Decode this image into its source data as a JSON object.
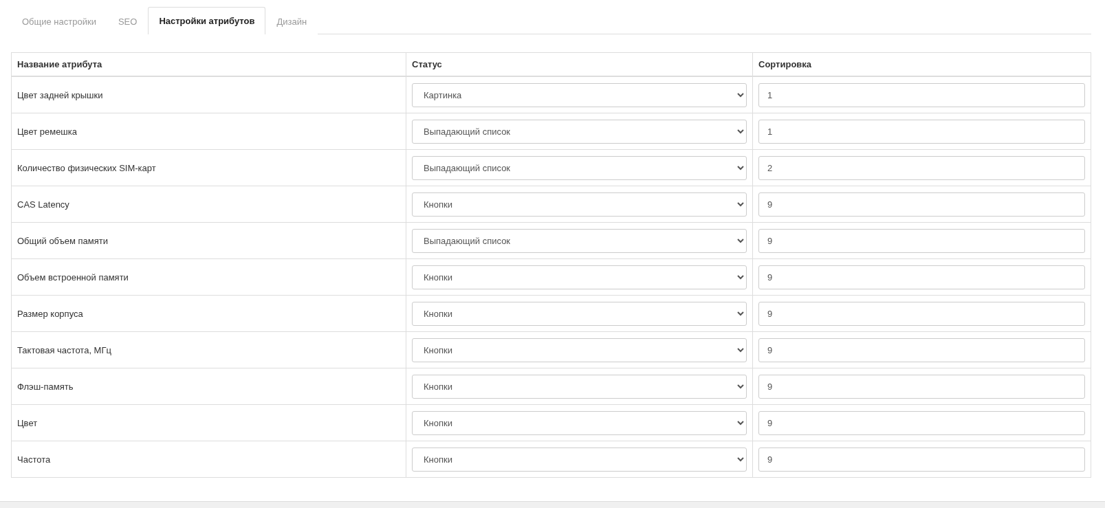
{
  "tabs": [
    {
      "label": "Общие настройки",
      "selected": false
    },
    {
      "label": "SEO",
      "selected": false
    },
    {
      "label": "Настройки атрибутов",
      "selected": true
    },
    {
      "label": "Дизайн",
      "selected": false
    }
  ],
  "table": {
    "columns": [
      "Название атрибута",
      "Статус",
      "Сортировка"
    ],
    "rows": [
      {
        "name": "Цвет задней крышки",
        "status": "Картинка",
        "sort": "1"
      },
      {
        "name": "Цвет ремешка",
        "status": "Выпадающий список",
        "sort": "1"
      },
      {
        "name": "Количество физических SIM-карт",
        "status": "Выпадающий список",
        "sort": "2"
      },
      {
        "name": "CAS Latency",
        "status": "Кнопки",
        "sort": "9"
      },
      {
        "name": "Общий объем памяти",
        "status": "Выпадающий список",
        "sort": "9"
      },
      {
        "name": "Объем встроенной памяти",
        "status": "Кнопки",
        "sort": "9"
      },
      {
        "name": "Размер корпуса",
        "status": "Кнопки",
        "sort": "9"
      },
      {
        "name": "Тактовая частота, МГц",
        "status": "Кнопки",
        "sort": "9"
      },
      {
        "name": "Флэш-память",
        "status": "Кнопки",
        "sort": "9"
      },
      {
        "name": "Цвет",
        "status": "Кнопки",
        "sort": "9"
      },
      {
        "name": "Частота",
        "status": "Кнопки",
        "sort": "9"
      }
    ]
  }
}
